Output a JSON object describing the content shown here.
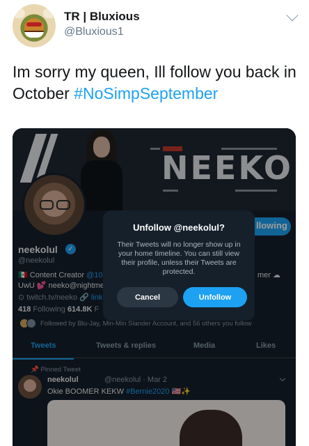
{
  "tweet": {
    "author_name": "TR | Bluxious",
    "author_handle": "@Bluxious1",
    "text_main": "Im sorry my queen, Ill follow you back in October ",
    "hashtag": "#NoSimpSeptember"
  },
  "embedded": {
    "banner": {
      "title": "NEEKO"
    },
    "following_button": "llowing",
    "profile": {
      "name": "neekolul",
      "handle": "@neekolul",
      "bio_line1_prefix": "🇲🇽 Content Creator ",
      "bio_line1_link": "@1001",
      "bio_line2": "UwU 💕 neeko@nightmedi",
      "bio_right": "mer ☁",
      "location_prefix": "⊙ twitch.tv/neeko  🔗 ",
      "location_link": "link",
      "following_count": "418",
      "following_label": " Following   ",
      "followers_count": "614.8K",
      "followers_label": " F",
      "followed_by": "Followed by Blu-Jay, Min-Min Slander Account, and 56 others you follow"
    },
    "tabs": [
      "Tweets",
      "Tweets & replies",
      "Media",
      "Likes"
    ],
    "pinned_tweet": {
      "pinned_label": "📌 Pinned Tweet",
      "name": "neekolul",
      "meta": "@neekolul · Mar 2",
      "text": "Okie BOOMER KEKW ",
      "hashtag": "#Bernie2020",
      "emoji": " 🇺🇸✨"
    },
    "modal": {
      "title": "Unfollow @neekolul?",
      "body": "Their Tweets will no longer show up in your home timeline. You can still view their profile, unless their Tweets are protected.",
      "cancel": "Cancel",
      "confirm": "Unfollow"
    }
  },
  "colors": {
    "accent": "#1da1f2",
    "dark_bg": "#15202b",
    "text_primary": "#14171a",
    "text_secondary": "#657786"
  },
  "icons": [
    "chevron-down-icon",
    "verified-badge-icon",
    "pin-icon",
    "location-icon",
    "link-icon"
  ]
}
